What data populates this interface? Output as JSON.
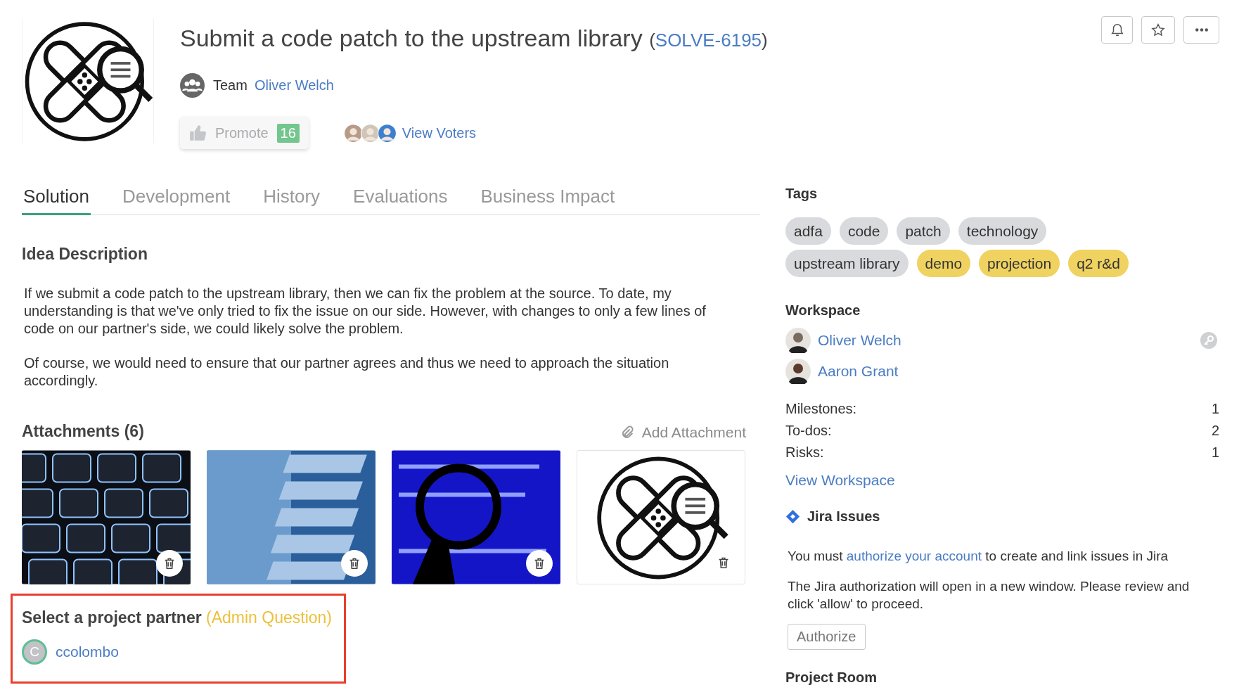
{
  "idea": {
    "title": "Submit a code patch to the upstream library",
    "key_open": "(",
    "key": "SOLVE-6195",
    "key_close": ")",
    "team_label": "Team",
    "team_name": "Oliver Welch"
  },
  "header_actions": [
    {
      "kind": "bell"
    },
    {
      "kind": "star"
    },
    {
      "kind": "more"
    }
  ],
  "promote": {
    "label": "Promote",
    "count": "16"
  },
  "voters": {
    "link": "View Voters"
  },
  "tabs": [
    {
      "label": "Solution",
      "selected": true
    },
    {
      "label": "Development",
      "selected": false
    },
    {
      "label": "History",
      "selected": false
    },
    {
      "label": "Evaluations",
      "selected": false
    },
    {
      "label": "Business Impact",
      "selected": false
    }
  ],
  "description": {
    "heading": "Idea Description",
    "paragraphs": [
      "If we submit a code patch to the upstream library, then we can fix the problem at the source. To date, my understanding is that we've only tried to fix the issue on our side. However, with changes to only a few lines of code on our partner's side, we could likely solve the problem.",
      "Of course, we would need to ensure that our partner agrees and thus we need to approach the situation accordingly."
    ]
  },
  "attachments": {
    "heading": "Attachments (6)",
    "add_label": "Add Attachment",
    "items": [
      {
        "kind": "keyboard"
      },
      {
        "kind": "code"
      },
      {
        "kind": "bug"
      },
      {
        "kind": "logo"
      }
    ]
  },
  "admin_question": {
    "question": "Select a project partner",
    "tag": "(Admin Question)",
    "answer": {
      "initial": "C",
      "name": "ccolombo"
    }
  },
  "tags": {
    "heading": "Tags",
    "items": [
      {
        "label": "adfa",
        "color": "#d8dadd"
      },
      {
        "label": "code",
        "color": "#d8dadd"
      },
      {
        "label": "patch",
        "color": "#d8dadd"
      },
      {
        "label": "technology",
        "color": "#d8dadd"
      },
      {
        "label": "upstream library",
        "color": "#d8dadd"
      },
      {
        "label": "demo",
        "color": "#efd260"
      },
      {
        "label": "projection",
        "color": "#efd260"
      },
      {
        "label": "q2 r&d",
        "color": "#efd260"
      }
    ]
  },
  "workspace": {
    "heading": "Workspace",
    "members": [
      {
        "name": "Oliver Welch",
        "key": true
      },
      {
        "name": "Aaron Grant",
        "key": false
      }
    ],
    "stats": [
      {
        "label": "Milestones:",
        "value": "1"
      },
      {
        "label": "To-dos:",
        "value": "2"
      },
      {
        "label": "Risks:",
        "value": "1"
      }
    ],
    "link": "View Workspace"
  },
  "jira": {
    "heading": "Jira Issues",
    "message_before": "You must",
    "message_link": "authorize your account",
    "message_after": "to create and link issues in Jira",
    "note": "The Jira authorization will open in a new window. Please review and click 'allow' to proceed.",
    "button": "Authorize"
  },
  "project_room": {
    "heading": "Project Room"
  }
}
